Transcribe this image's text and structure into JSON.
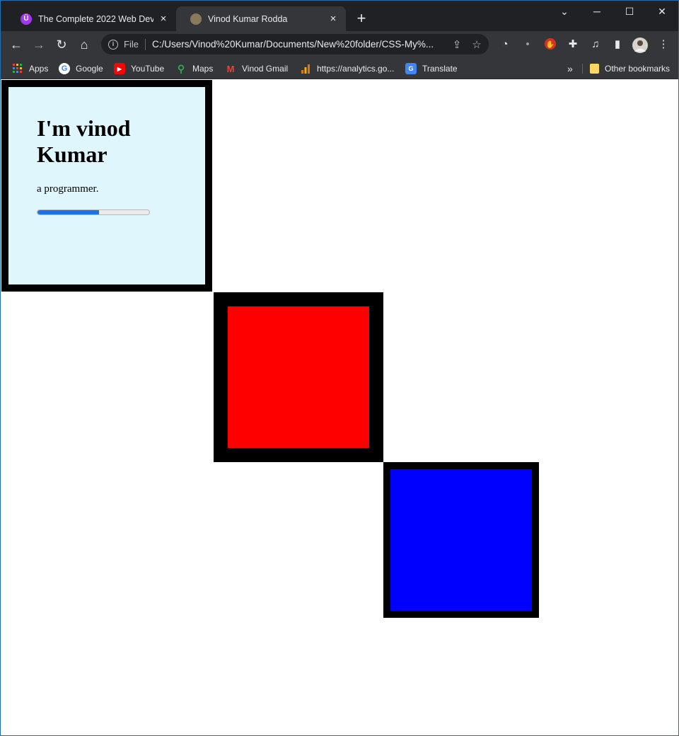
{
  "tabs": [
    {
      "title": "The Complete 2022 Web Develop",
      "favicon": "Ü"
    },
    {
      "title": "Vinod Kumar Rodda",
      "favicon": ""
    }
  ],
  "window_controls": {
    "minimize": "─",
    "maximize": "☐",
    "close": "✕",
    "tab_search": "⌄"
  },
  "address": {
    "scheme": "File",
    "url": "C:/Users/Vinod%20Kumar/Documents/New%20folder/CSS-My%..."
  },
  "bookmarks": [
    {
      "label": "Apps",
      "icon": "apps-grid-icon"
    },
    {
      "label": "Google",
      "icon": "google-icon"
    },
    {
      "label": "YouTube",
      "icon": "youtube-icon"
    },
    {
      "label": "Maps",
      "icon": "maps-icon"
    },
    {
      "label": "Vinod Gmail",
      "icon": "gmail-icon"
    },
    {
      "label": "https://analytics.go...",
      "icon": "analytics-icon"
    },
    {
      "label": "Translate",
      "icon": "translate-icon"
    }
  ],
  "other_bookmarks": "Other bookmarks",
  "overflow": "»",
  "page": {
    "heading": "I'm vinod Kumar",
    "subtitle": "a programmer.",
    "progress_percent": 55,
    "card_color": "#e0f6fd",
    "box1_color": "#ff0000",
    "box2_color": "#0000ff"
  }
}
